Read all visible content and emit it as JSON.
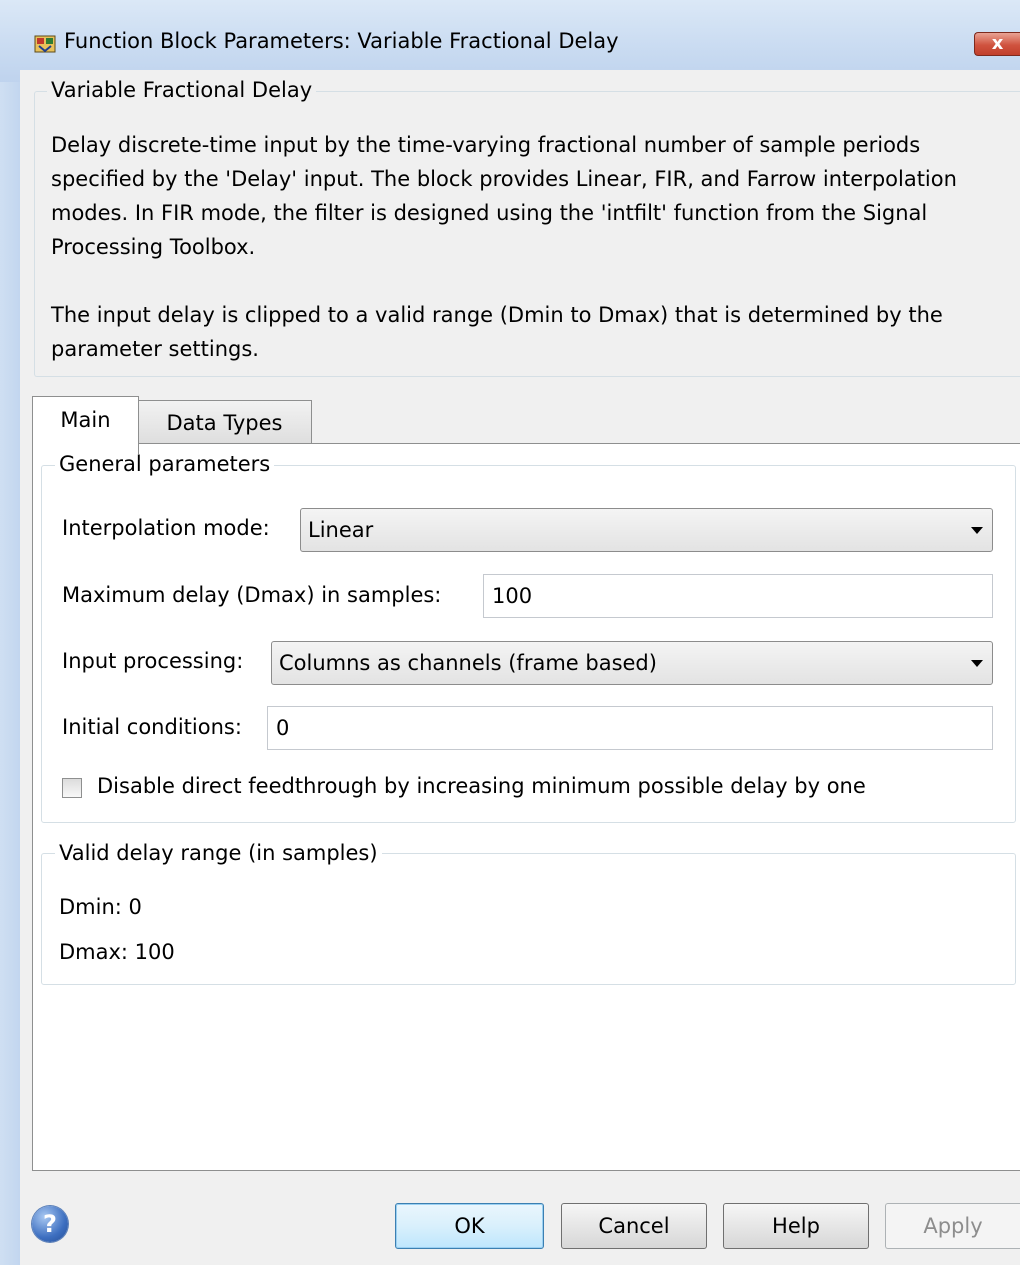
{
  "window": {
    "title": "Function Block Parameters: Variable Fractional Delay",
    "close_label": "x"
  },
  "description": {
    "group_label": "Variable Fractional Delay",
    "paragraph1": "Delay discrete-time input by the time-varying fractional number of sample periods specified by the 'Delay' input. The block provides Linear, FIR, and Farrow interpolation modes. In FIR mode, the filter is designed using the 'intfilt' function from the Signal Processing Toolbox.",
    "paragraph2": "The input delay is clipped to a valid range (Dmin to Dmax) that is determined by the parameter settings."
  },
  "tabs": [
    {
      "label": "Main",
      "selected": true
    },
    {
      "label": "Data Types",
      "selected": false
    }
  ],
  "general": {
    "group_label": "General parameters",
    "interp_label": "Interpolation mode:",
    "interp_value": "Linear",
    "maxdelay_label": "Maximum delay (Dmax) in samples:",
    "maxdelay_value": "100",
    "inproc_label": "Input processing:",
    "inproc_value": "Columns as channels (frame based)",
    "initcond_label": "Initial conditions:",
    "initcond_value": "0",
    "feedthrough_label": "Disable direct feedthrough by increasing minimum possible delay by one",
    "feedthrough_checked": false
  },
  "valid_range": {
    "group_label": "Valid delay range (in samples)",
    "dmin": "Dmin: 0",
    "dmax": "Dmax: 100"
  },
  "buttons": {
    "help_icon": "?",
    "ok": "OK",
    "cancel": "Cancel",
    "help": "Help",
    "apply": "Apply"
  },
  "colors": {
    "titlebar": "#c9dbf1",
    "close_button": "#d0533f",
    "panel_bg": "#f0f0f0",
    "ok_button_border": "#3c7fb1"
  }
}
